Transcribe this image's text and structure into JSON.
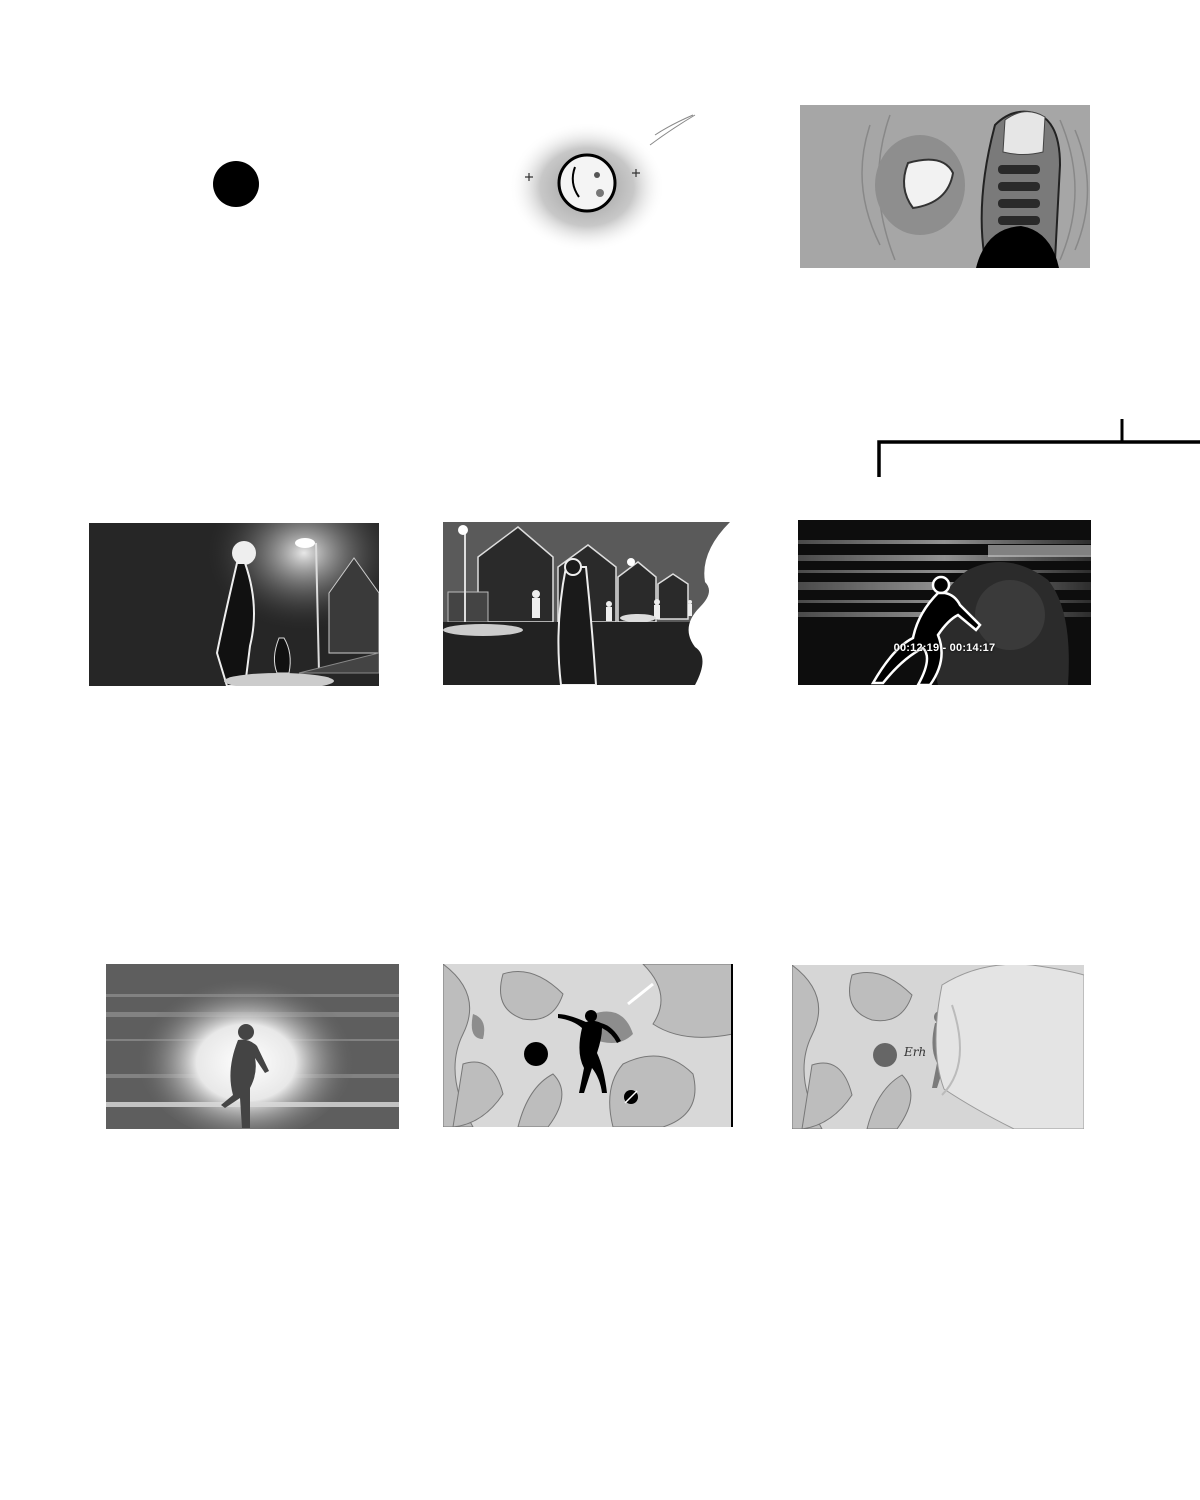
{
  "storyboard": {
    "rows": [
      {
        "panels": [
          {
            "id": "ball-dot"
          },
          {
            "id": "moon-ball"
          },
          {
            "id": "shoe-kick"
          }
        ]
      },
      {
        "panels": [
          {
            "id": "street-night-figure"
          },
          {
            "id": "houses-street"
          },
          {
            "id": "runner-speed",
            "timecode": "00:12:19 - 00:14:17"
          }
        ]
      },
      {
        "panels": [
          {
            "id": "glow-runner"
          },
          {
            "id": "abstract-dancer"
          },
          {
            "id": "abstract-hand",
            "scribble": "Erh"
          }
        ]
      }
    ]
  },
  "colors": {
    "background": "#ffffff",
    "ink": "#000000",
    "dark_panel": "#2a2a2a",
    "mid_gray": "#a6a6a6"
  }
}
